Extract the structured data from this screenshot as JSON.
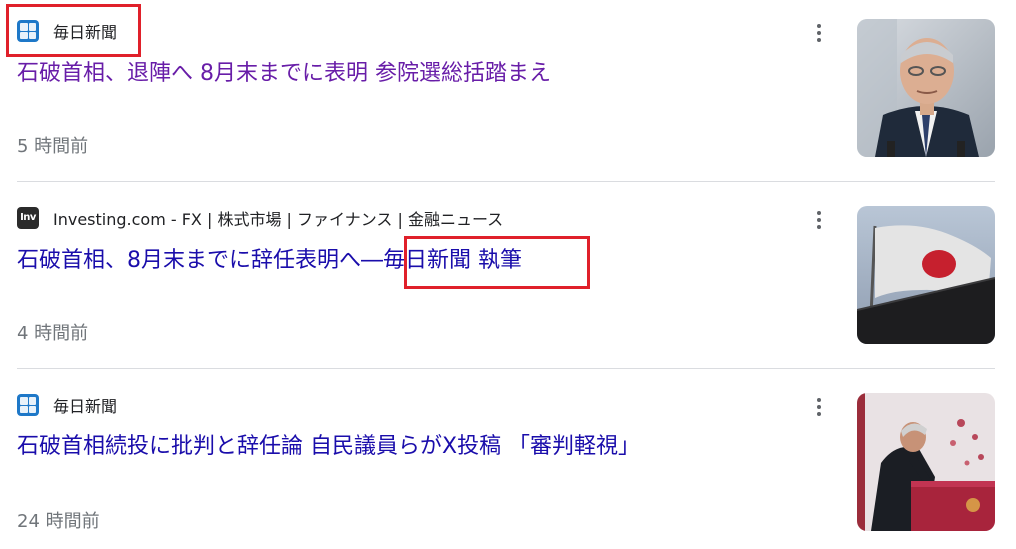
{
  "results": [
    {
      "source_name": "毎日新聞",
      "favicon": "mainichi-favicon",
      "headline": "石破首相、退陣へ 8月末までに表明 参院選総括踏まえ",
      "visited": true,
      "time": "5 時間前",
      "thumbnail": "portrait-of-man-in-suit"
    },
    {
      "source_name": "Investing.com - FX | 株式市場 | ファイナンス | 金融ニュース",
      "favicon": "investing-favicon",
      "favicon_text": "Inv",
      "headline_part1": "石破首相、8月末までに辞任表明へ―",
      "headline_part2": "毎日新聞 執筆",
      "visited": false,
      "time": "4 時間前",
      "thumbnail": "japanese-flag-on-building"
    },
    {
      "source_name": "毎日新聞",
      "favicon": "mainichi-favicon",
      "headline": "石破首相続投に批判と辞任論 自民議員らがX投稿 「審判軽視」",
      "visited": false,
      "time": "24 時間前",
      "thumbnail": "man-bowing-at-podium"
    }
  ],
  "colors": {
    "link": "#1a0dab",
    "visited_link": "#681da8",
    "time": "#70757a",
    "highlight_box": "#e0202a"
  },
  "icons": {
    "more_options": "more-vert-icon"
  }
}
